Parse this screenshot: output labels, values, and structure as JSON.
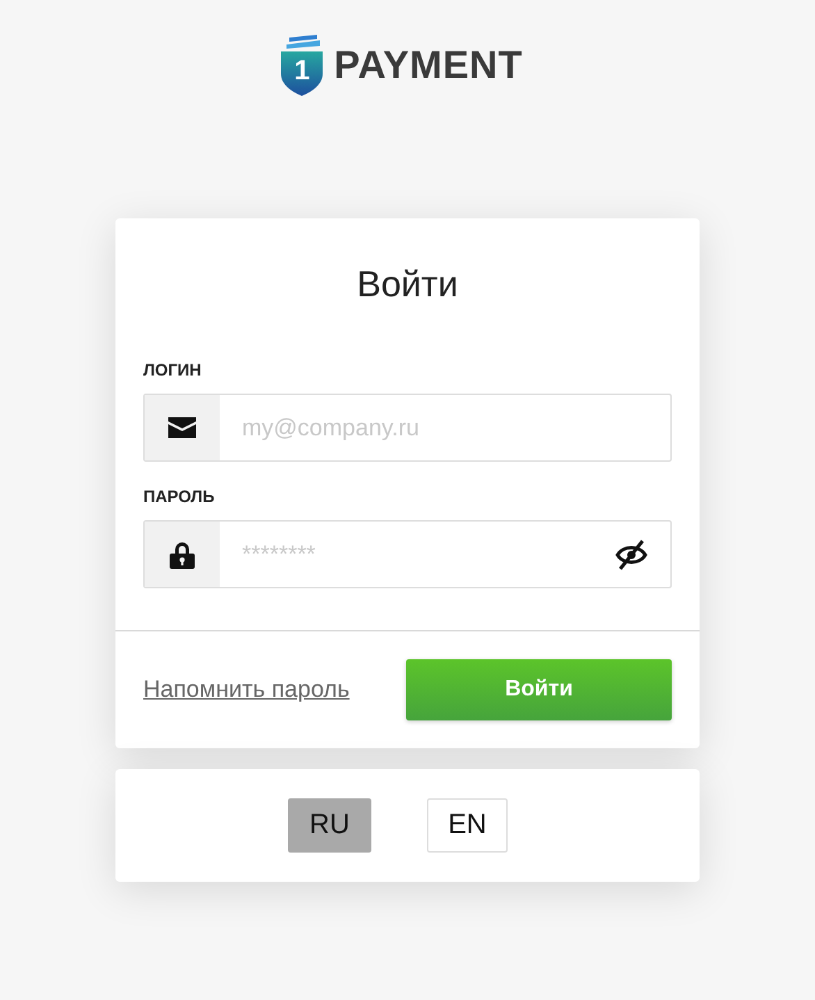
{
  "logo": {
    "mark": "1",
    "text": "PAYMENT"
  },
  "form": {
    "title": "Войти",
    "fields": [
      {
        "kind": "email",
        "label": "ЛОГИН",
        "placeholder": "my@company.ru"
      },
      {
        "kind": "password",
        "label": "ПАРОЛЬ",
        "placeholder": "********"
      }
    ],
    "forgot_link": "Напомнить пароль",
    "submit": "Войти"
  },
  "languages": [
    {
      "label": "RU",
      "selected": true
    },
    {
      "label": "EN",
      "selected": false
    }
  ]
}
